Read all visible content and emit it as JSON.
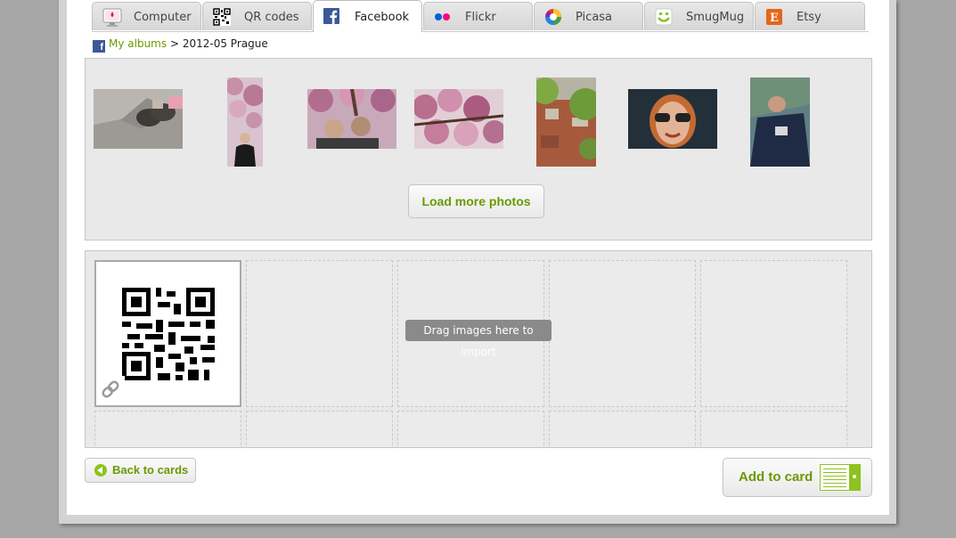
{
  "tabs": [
    {
      "label": "Computer",
      "icon": "computer-icon",
      "active": false
    },
    {
      "label": "QR codes",
      "icon": "qr-code-icon",
      "active": false
    },
    {
      "label": "Facebook",
      "icon": "facebook-icon",
      "active": true
    },
    {
      "label": "Flickr",
      "icon": "flickr-icon",
      "active": false
    },
    {
      "label": "Picasa",
      "icon": "picasa-icon",
      "active": false
    },
    {
      "label": "SmugMug",
      "icon": "smugmug-icon",
      "active": false
    },
    {
      "label": "Etsy",
      "icon": "etsy-icon",
      "active": false
    }
  ],
  "breadcrumb": {
    "root_label": "My albums",
    "separator": ">",
    "current": "2012-05 Prague"
  },
  "photos": [
    {
      "name": "photo-shoes-on-pavement"
    },
    {
      "name": "photo-girl-under-blossoms"
    },
    {
      "name": "photo-couple-under-blossoms"
    },
    {
      "name": "photo-pink-blossoms"
    },
    {
      "name": "photo-city-rooftops"
    },
    {
      "name": "photo-woman-sunglasses"
    },
    {
      "name": "photo-person-lying-down"
    }
  ],
  "load_more_label": "Load more photos",
  "drag_hint": "Drag images here to import",
  "back_label": "Back to cards",
  "add_label": "Add to card",
  "colors": {
    "accent": "#6a9a00",
    "accent_light": "#8dc21f",
    "facebook": "#3b5998",
    "etsy": "#e3661b"
  }
}
